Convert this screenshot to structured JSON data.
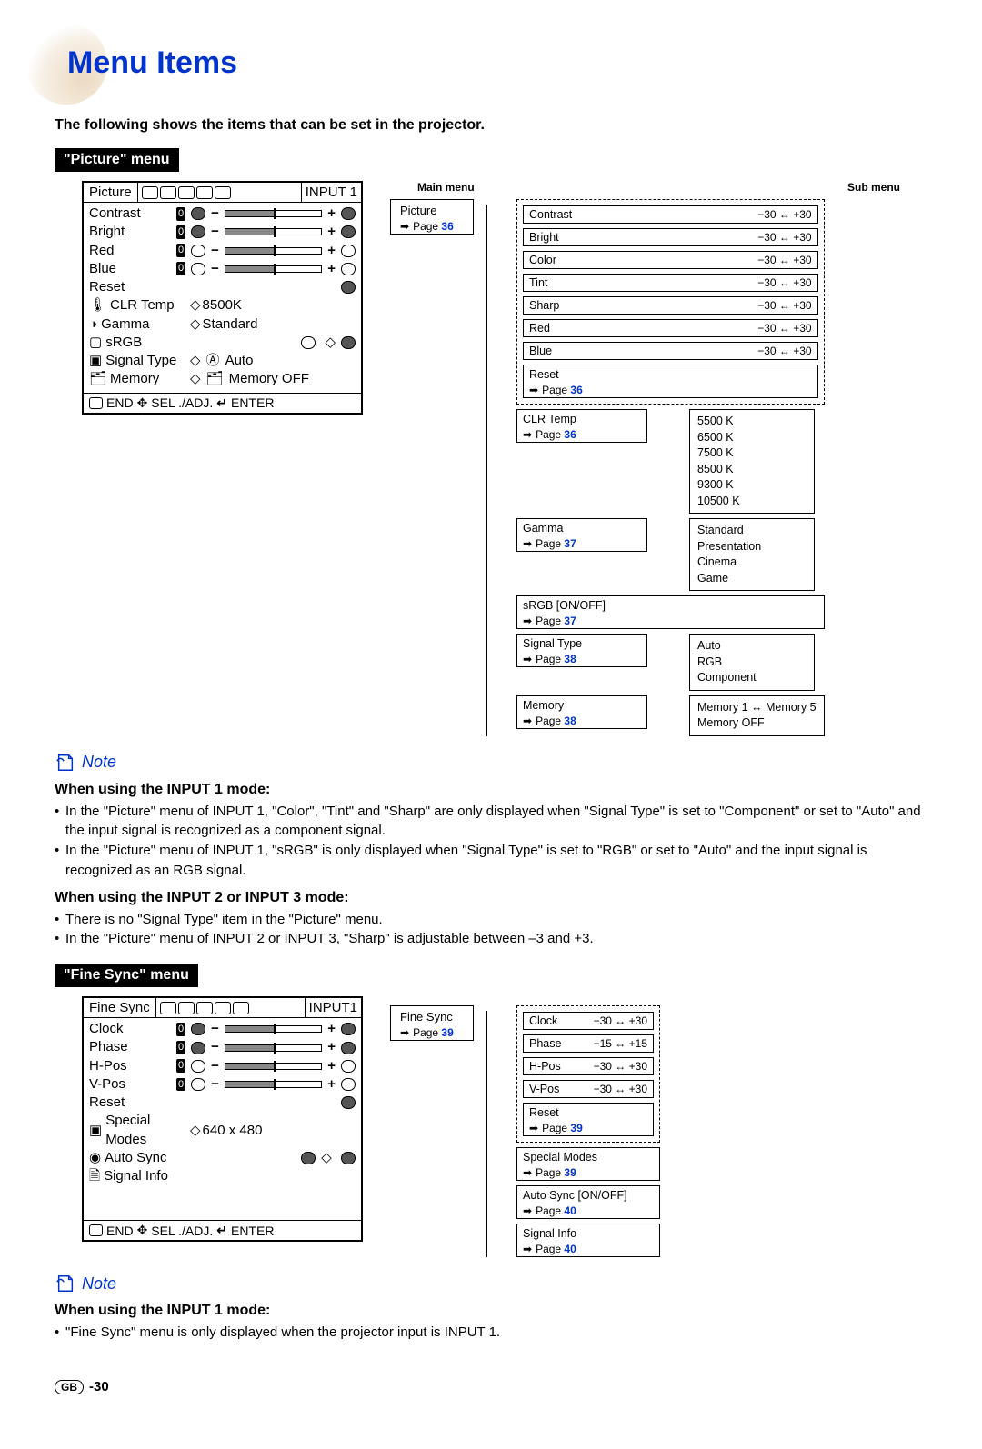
{
  "page": {
    "title": "Menu Items",
    "intro": "The following shows the items that can be set in the projector.",
    "footer_region": "GB",
    "footer_page": "-30"
  },
  "picture": {
    "menu_label": "\"Picture\" menu",
    "osd": {
      "title": "Picture",
      "input": "INPUT 1",
      "rows": [
        {
          "name": "Contrast",
          "val": "0"
        },
        {
          "name": "Bright",
          "val": "0"
        },
        {
          "name": "Red",
          "val": "0"
        },
        {
          "name": "Blue",
          "val": "0"
        }
      ],
      "reset": "Reset",
      "clr": "CLR Temp",
      "clr_val": "8500K",
      "gamma": "Gamma",
      "gamma_val": "Standard",
      "srgb": "sRGB",
      "signal": "Signal Type",
      "signal_val": "Auto",
      "memory": "Memory",
      "memory_val": "Memory OFF",
      "footer": "END",
      "footer_sel": "SEL ./ADJ.",
      "footer_enter": "ENTER"
    },
    "main_col_label": "Main menu",
    "sub_col_label": "Sub menu",
    "main_box": {
      "title": "Picture",
      "page": "36"
    },
    "adjust_group": [
      {
        "name": "Contrast",
        "range": "−30 ↔ +30"
      },
      {
        "name": "Bright",
        "range": "−30 ↔ +30"
      },
      {
        "name": "Color",
        "range": "−30 ↔ +30"
      },
      {
        "name": "Tint",
        "range": "−30 ↔ +30"
      },
      {
        "name": "Sharp",
        "range": "−30 ↔ +30"
      },
      {
        "name": "Red",
        "range": "−30 ↔ +30"
      },
      {
        "name": "Blue",
        "range": "−30 ↔ +30"
      }
    ],
    "reset_box": {
      "name": "Reset",
      "page": "36"
    },
    "clr_box": {
      "name": "CLR Temp",
      "page": "36"
    },
    "clr_opts": [
      "5500 K",
      "6500 K",
      "7500 K",
      "8500 K",
      "9300 K",
      "10500 K"
    ],
    "gamma_box": {
      "name": "Gamma",
      "page": "37"
    },
    "gamma_opts": [
      "Standard",
      "Presentation",
      "Cinema",
      "Game"
    ],
    "srgb_box": {
      "name": "sRGB [ON/OFF]",
      "page": "37"
    },
    "signal_box": {
      "name": "Signal Type",
      "page": "38"
    },
    "signal_opts": [
      "Auto",
      "RGB",
      "Component"
    ],
    "memory_box": {
      "name": "Memory",
      "page": "38"
    },
    "memory_opts": [
      "Memory 1 ↔ Memory 5",
      "Memory OFF"
    ]
  },
  "note_label": "Note",
  "picture_notes": {
    "h1": "When using the INPUT 1 mode:",
    "b1": "In the \"Picture\" menu of INPUT 1, \"Color\", \"Tint\" and \"Sharp\" are only displayed when \"Signal Type\" is set to \"Component\" or set to \"Auto\" and the input signal is recognized as a component signal.",
    "b2": "In the \"Picture\" menu of INPUT 1, \"sRGB\" is only displayed when \"Signal Type\" is set to \"RGB\" or set to \"Auto\" and the input signal is recognized as an RGB signal.",
    "h2": "When using the INPUT 2 or INPUT 3 mode:",
    "b3": "There is no \"Signal Type\" item in the \"Picture\" menu.",
    "b4": "In the \"Picture\" menu of INPUT 2 or INPUT 3, \"Sharp\" is adjustable between –3 and +3."
  },
  "finesync": {
    "menu_label": "\"Fine Sync\" menu",
    "osd": {
      "title": "Fine Sync",
      "input": "INPUT1",
      "rows": [
        {
          "name": "Clock",
          "val": "0"
        },
        {
          "name": "Phase",
          "val": "0"
        },
        {
          "name": "H-Pos",
          "val": "0"
        },
        {
          "name": "V-Pos",
          "val": "0"
        }
      ],
      "reset": "Reset",
      "special": "Special Modes",
      "special_val": "640 x 480",
      "autosync": "Auto Sync",
      "siginfo": "Signal Info",
      "footer": "END",
      "footer_sel": "SEL ./ADJ.",
      "footer_enter": "ENTER"
    },
    "main_box": {
      "title": "Fine Sync",
      "page": "39"
    },
    "adjust_group": [
      {
        "name": "Clock",
        "range": "−30 ↔ +30"
      },
      {
        "name": "Phase",
        "range": "−15 ↔ +15"
      },
      {
        "name": "H-Pos",
        "range": "−30 ↔ +30"
      },
      {
        "name": "V-Pos",
        "range": "−30 ↔ +30"
      }
    ],
    "reset_box": {
      "name": "Reset",
      "page": "39"
    },
    "special_box": {
      "name": "Special Modes",
      "page": "39"
    },
    "auto_box": {
      "name": "Auto Sync [ON/OFF]",
      "page": "40"
    },
    "info_box": {
      "name": "Signal Info",
      "page": "40"
    }
  },
  "finesync_notes": {
    "h1": "When using the INPUT 1 mode:",
    "b1": "\"Fine Sync\" menu is only displayed when the projector input is INPUT 1."
  }
}
